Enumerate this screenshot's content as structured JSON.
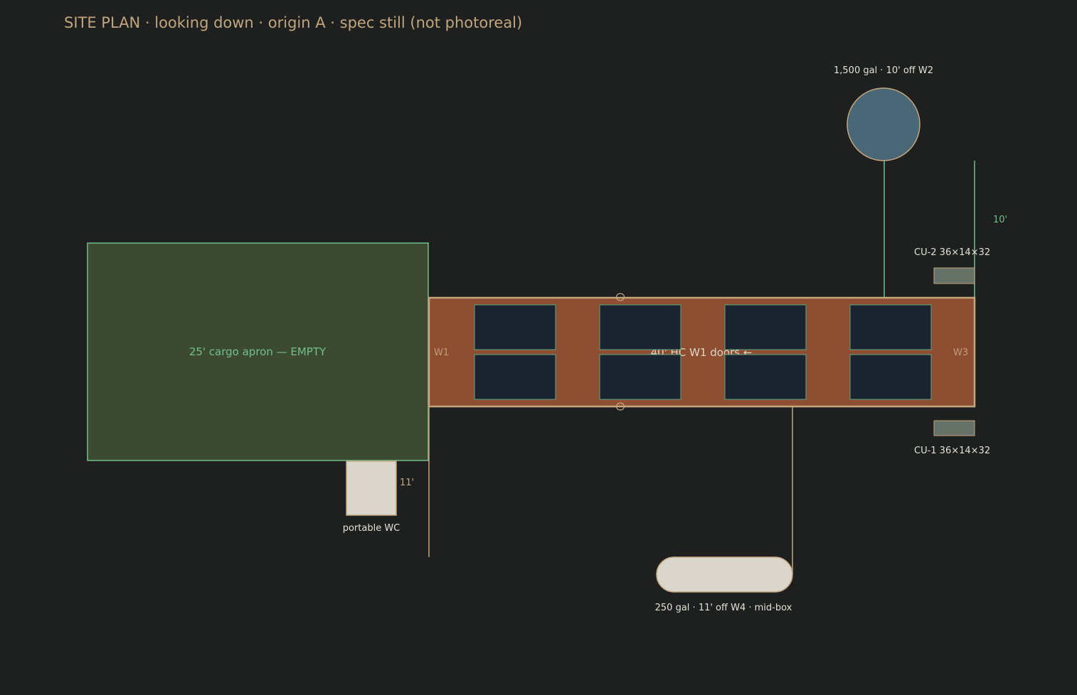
{
  "title": "SITE PLAN  ·  looking down  ·  origin A  ·  spec still (not photoreal)",
  "apron": {
    "label": "25' cargo apron — EMPTY"
  },
  "container": {
    "label": "40' HC   W1 doors ←",
    "wall_left": "W1",
    "wall_right": "W3"
  },
  "tank_large": {
    "label": "1,500 gal  ·  10' off W2"
  },
  "tank_small": {
    "label": "250 gal  ·  11' off W4  ·  mid-box"
  },
  "wc": {
    "label": "portable WC",
    "dimension": "11'"
  },
  "cu2": {
    "label": "CU-2  36×14×32"
  },
  "cu1": {
    "label": "CU-1  36×14×32"
  },
  "dim_right": "10'",
  "colors": {
    "background": "#1d201f",
    "apron_fill": "#3c4a32",
    "apron_stroke": "#71c08a",
    "container_fill": "#8d4e32",
    "container_stroke": "#c3a57e",
    "panel_fill": "#1b2430",
    "panel_stroke": "#5da77f",
    "tank_large_fill": "#4a6777",
    "tank_small_fill": "#dad6cb",
    "wc_fill": "#dad6cb",
    "cu_fill": "#667168",
    "title_color": "#c3a57e"
  }
}
